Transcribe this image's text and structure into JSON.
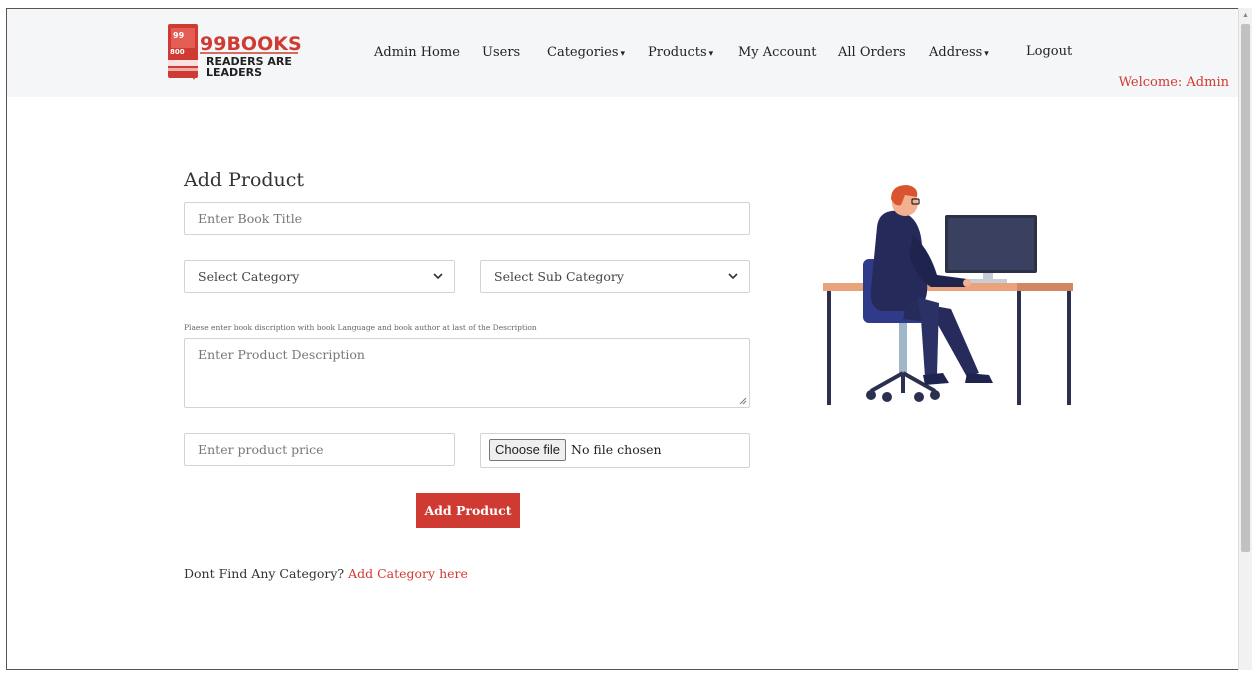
{
  "brand": {
    "name": "99BOOKS",
    "tagline_line1": "READERS ARE",
    "tagline_line2": "LEADERS",
    "badge_top": "99",
    "badge_bottom": "800"
  },
  "nav": {
    "items": [
      {
        "label": "Admin Home",
        "dropdown": false
      },
      {
        "label": "Users",
        "dropdown": false
      },
      {
        "label": "Categories",
        "dropdown": true
      },
      {
        "label": "Products",
        "dropdown": true
      },
      {
        "label": "My Account",
        "dropdown": false
      },
      {
        "label": "All Orders",
        "dropdown": false
      },
      {
        "label": "Address",
        "dropdown": true
      },
      {
        "label": "Logout",
        "dropdown": false
      }
    ],
    "caret": "▾",
    "welcome": "Welcome: Admin"
  },
  "form": {
    "heading": "Add Product",
    "title_placeholder": "Enter Book Title",
    "category_selected": "Select Category",
    "subcategory_selected": "Select Sub Category",
    "description_hint": "Plaese enter book discription with book Language and book author at last of the Description",
    "description_placeholder": "Enter Product Description",
    "price_placeholder": "Enter product price",
    "file_button": "Choose file",
    "file_status": "No file chosen",
    "submit_label": "Add Product"
  },
  "footer": {
    "question": "Dont Find Any Category?",
    "link": "Add Category here"
  },
  "colors": {
    "accent": "#cf3b33",
    "navbar_bg": "#f5f6f8"
  }
}
